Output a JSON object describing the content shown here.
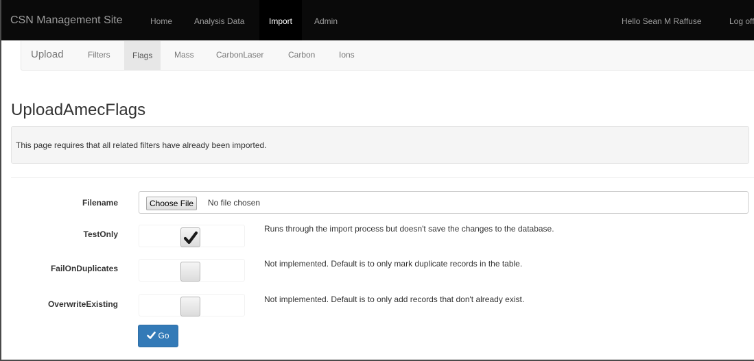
{
  "navbar": {
    "brand": "CSN Management Site",
    "items": [
      {
        "label": "Home",
        "active": false
      },
      {
        "label": "Analysis Data",
        "active": false
      },
      {
        "label": "Import",
        "active": true
      },
      {
        "label": "Admin",
        "active": false
      }
    ],
    "greeting": "Hello Sean M Raffuse",
    "logoff": "Log off"
  },
  "subnav": {
    "brand": "Upload",
    "items": [
      {
        "label": "Filters",
        "active": false
      },
      {
        "label": "Flags",
        "active": true
      },
      {
        "label": "Mass",
        "active": false
      },
      {
        "label": "CarbonLaser",
        "active": false
      },
      {
        "label": "Carbon",
        "active": false
      },
      {
        "label": "Ions",
        "active": false
      }
    ]
  },
  "page": {
    "title": "UploadAmecFlags",
    "notice": "This page requires that all related filters have already been imported."
  },
  "form": {
    "filename": {
      "label": "Filename",
      "button": "Choose File",
      "status": "No file chosen"
    },
    "test_only": {
      "label": "TestOnly",
      "checked": true,
      "help": "Runs through the import process but doesn't save the changes to the database."
    },
    "fail_on_duplicates": {
      "label": "FailOnDuplicates",
      "checked": false,
      "help": "Not implemented. Default is to only mark duplicate records in the table."
    },
    "overwrite_existing": {
      "label": "OverwriteExisting",
      "checked": false,
      "help": "Not implemented. Default is to only add records that don't already exist."
    },
    "submit_label": "Go"
  },
  "colors": {
    "navbar_bg": "#0a0a0a",
    "primary": "#337ab7"
  },
  "icons": {
    "checkbox_mark": "checkmark-icon",
    "submit_icon": "check-icon"
  }
}
